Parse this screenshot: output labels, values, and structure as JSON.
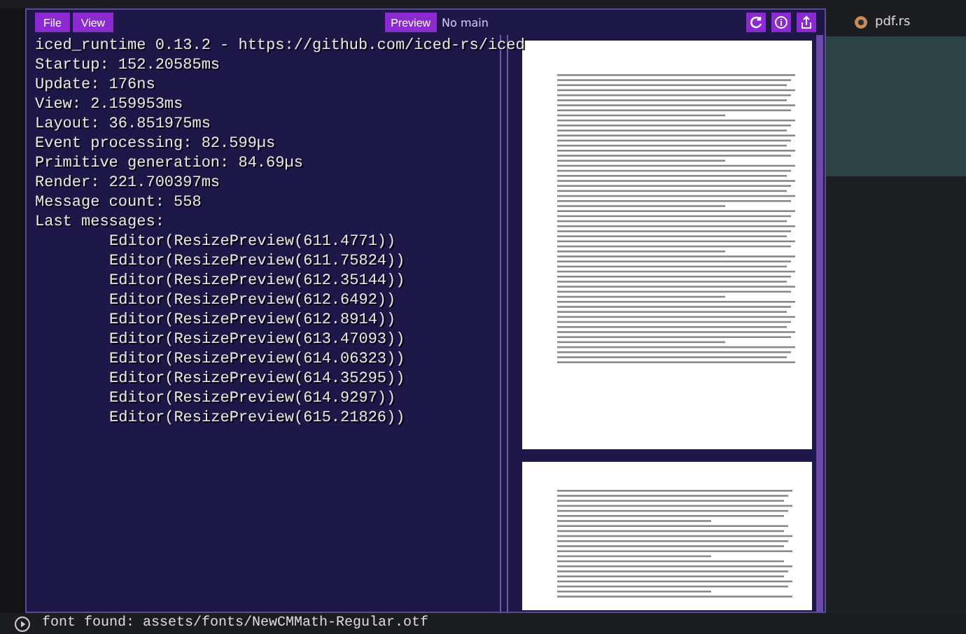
{
  "app_window": {
    "menu": [
      {
        "label": "File"
      },
      {
        "label": "View"
      }
    ],
    "preview_button": "Preview",
    "main_status": "No main"
  },
  "debug_overlay": {
    "title": "iced_runtime 0.13.2 - https://github.com/iced-rs/iced",
    "stats": [
      "Startup: 152.20585ms",
      "Update: 176ns",
      "View: 2.159953ms",
      "Layout: 36.851975ms",
      "Event processing: 82.599µs",
      "Primitive generation: 84.69µs",
      "Render: 221.700397ms",
      "Message count: 558"
    ],
    "last_messages_label": "Last messages:",
    "messages": [
      "Editor(ResizePreview(611.4771))",
      "Editor(ResizePreview(611.75824))",
      "Editor(ResizePreview(612.35144))",
      "Editor(ResizePreview(612.6492))",
      "Editor(ResizePreview(612.8914))",
      "Editor(ResizePreview(613.47093))",
      "Editor(ResizePreview(614.06323))",
      "Editor(ResizePreview(614.35295))",
      "Editor(ResizePreview(614.9297))",
      "Editor(ResizePreview(615.21826))"
    ]
  },
  "editor_tab": {
    "label": "pdf.rs"
  },
  "terminal": {
    "line": "font found: assets/fonts/NewCMMath-Regular.otf"
  }
}
